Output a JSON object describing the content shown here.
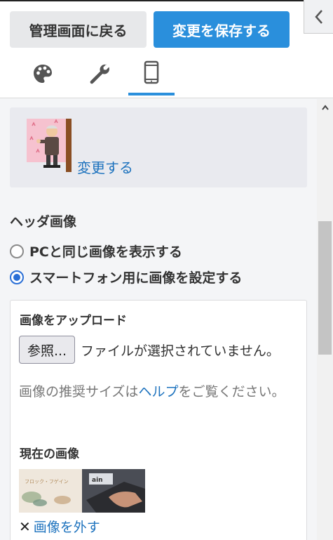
{
  "header": {
    "back_label": "管理画面に戻る",
    "save_label": "変更を保存する",
    "tabs": [
      {
        "icon": "palette-icon"
      },
      {
        "icon": "wrench-icon"
      },
      {
        "icon": "smartphone-icon",
        "active": true
      }
    ]
  },
  "logo": {
    "change_label": "変更する"
  },
  "header_image": {
    "title": "ヘッダ画像",
    "options": [
      {
        "label": "PCと同じ画像を表示する",
        "checked": false
      },
      {
        "label": "スマートフォン用に画像を設定する",
        "checked": true
      }
    ],
    "upload_label": "画像をアップロード",
    "browse_label": "参照...",
    "no_file_text": "ファイルが選択されていません。",
    "hint_before": "画像の推奨サイズは",
    "hint_link": "ヘルプ",
    "hint_after": "をご覧ください。",
    "current_label": "現在の画像",
    "thumbnail_text_left": "フロック・フゲイン",
    "thumbnail_text_right": "ain",
    "remove_label": "画像を外す"
  },
  "colors": {
    "accent": "#2a8fdc",
    "link": "#1e73be"
  }
}
